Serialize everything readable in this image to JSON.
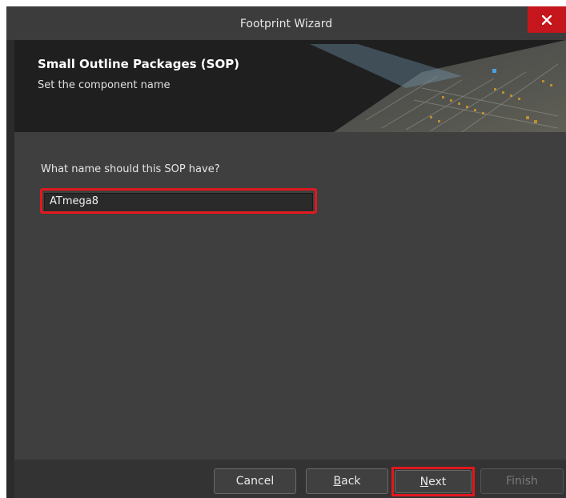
{
  "window": {
    "title": "Footprint Wizard",
    "close_icon": "close-icon"
  },
  "banner": {
    "title": "Small Outline Packages (SOP)",
    "subtitle": "Set the component name"
  },
  "content": {
    "question": "What name should this SOP have?",
    "name_value": "ATmega8"
  },
  "footer": {
    "cancel": "Cancel",
    "back_prefix": "",
    "back_accel": "B",
    "back_rest": "ack",
    "next_prefix": "",
    "next_accel": "N",
    "next_rest": "ext",
    "finish": "Finish"
  },
  "colors": {
    "close_bg": "#c4161c",
    "highlight": "#e0181e",
    "content_bg": "#3f3f3f"
  }
}
